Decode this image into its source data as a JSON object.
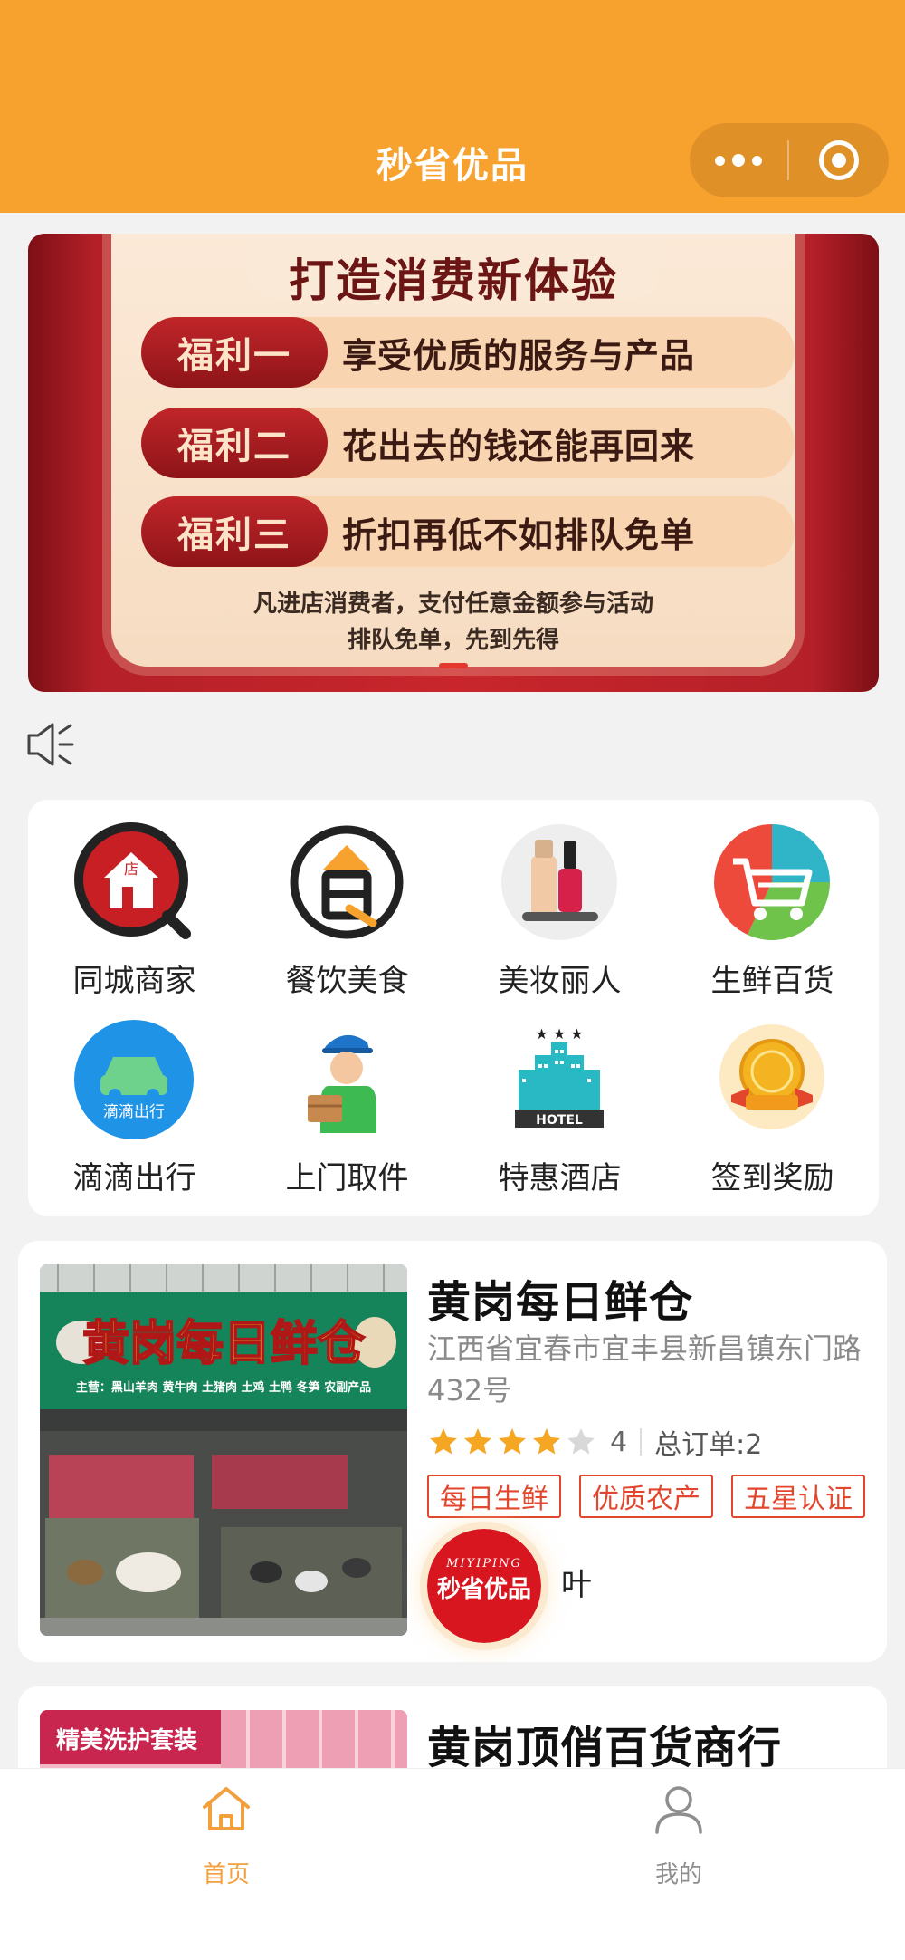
{
  "header": {
    "title": "秒省优品",
    "more_icon": "more-dots-icon",
    "close_icon": "target-circle-icon"
  },
  "banner": {
    "title": "打造消费新体验",
    "perks": [
      {
        "label": "福利一",
        "text": "享受优质的服务与产品"
      },
      {
        "label": "福利二",
        "text": "花出去的钱还能再回来"
      },
      {
        "label": "福利三",
        "text": "折扣再低不如排队免单"
      }
    ],
    "note_line1": "凡进店消费者，支付任意金额参与活动",
    "note_line2": "排队免单，先到先得",
    "active_slide": 1
  },
  "notice": {
    "icon": "speaker-icon"
  },
  "categories": [
    {
      "label": "同城商家",
      "icon": "local-store-icon"
    },
    {
      "label": "餐饮美食",
      "icon": "food-icon"
    },
    {
      "label": "美妆丽人",
      "icon": "cosmetics-icon"
    },
    {
      "label": "生鲜百货",
      "icon": "shopping-cart-icon"
    },
    {
      "label": "滴滴出行",
      "icon": "car-icon",
      "icon_text": "滴滴出行"
    },
    {
      "label": "上门取件",
      "icon": "courier-icon"
    },
    {
      "label": "特惠酒店",
      "icon": "hotel-icon",
      "icon_text": "HOTEL"
    },
    {
      "label": "签到奖励",
      "icon": "reward-medal-icon"
    }
  ],
  "stores": [
    {
      "name": "黄岗每日鲜仓",
      "address": "江西省宜春市宜丰县新昌镇东门路432号",
      "rating": 4,
      "orders": "总订单:2",
      "tags": [
        "每日生鲜",
        "优质农产",
        "五星认证"
      ],
      "owner_logo_text_top": "MIYIPING",
      "owner_logo_text": "秒省优品",
      "owner_name": "叶",
      "photo_sign": "黄岗每日鲜仓",
      "photo_sub": "主营：黑山羊肉 黄牛肉 土猪肉 土鸡 土鸭 冬笋 农副产品"
    },
    {
      "name": "黄岗顶俏百货商行",
      "photo_label": "精美洗护套装"
    }
  ],
  "tabbar": [
    {
      "label": "首页",
      "icon": "home-icon",
      "active": true
    },
    {
      "label": "我的",
      "icon": "user-icon",
      "active": false
    }
  ],
  "colors": {
    "brand": "#f7a22e",
    "active_tab": "#f2a03d",
    "inactive_tab": "#8e8e8e",
    "tag_red": "#e2462c",
    "star": "#f5a623"
  }
}
